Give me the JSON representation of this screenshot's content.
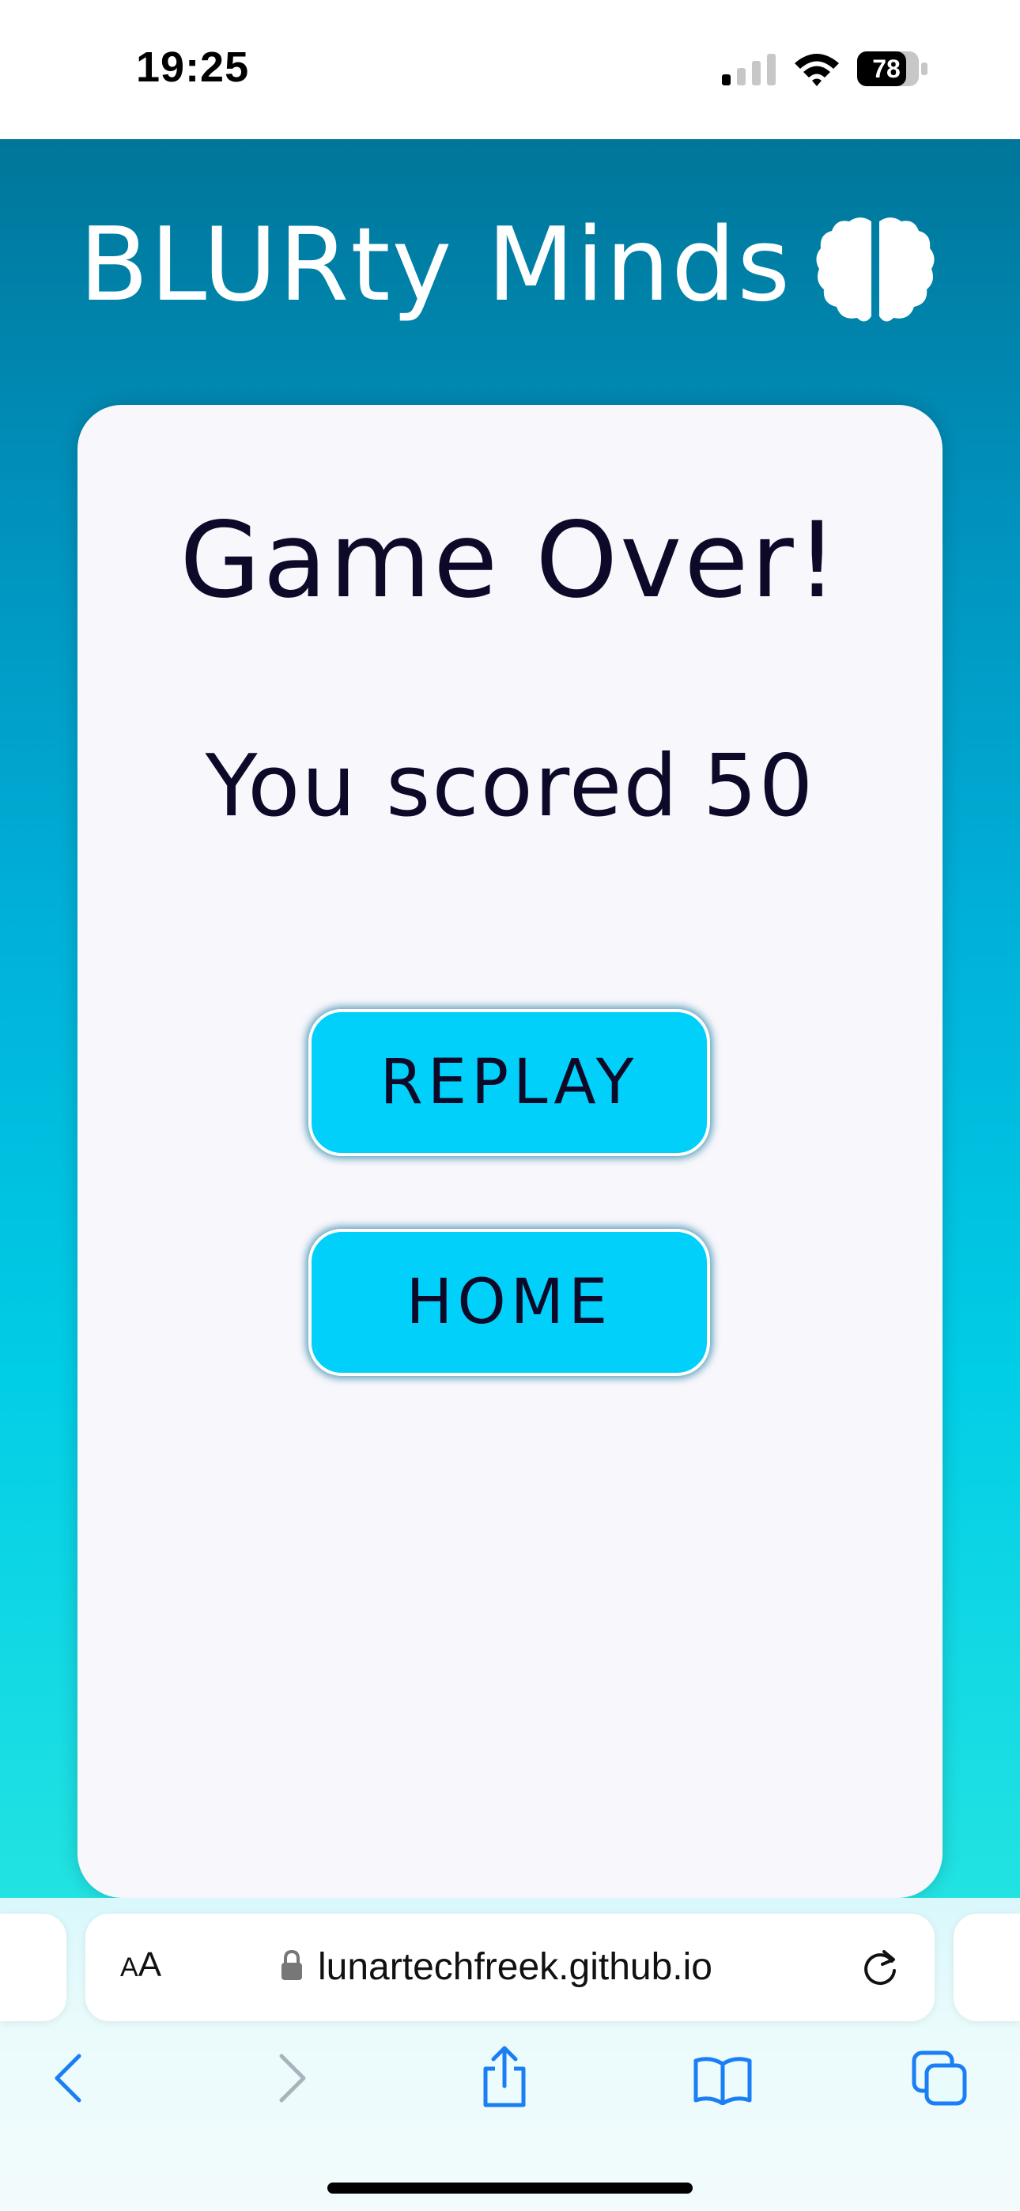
{
  "status_bar": {
    "time": "19:25",
    "battery": "78",
    "icons": [
      "signal-icon",
      "wifi-icon",
      "battery-icon"
    ]
  },
  "header": {
    "title": "BLURty Minds",
    "logo_icon": "brain-icon"
  },
  "card": {
    "title": "Game Over!",
    "score_prefix": "You scored",
    "score_value": "50",
    "buttons": {
      "replay": "REPLAY",
      "home": "HOME"
    }
  },
  "browser": {
    "reader_small": "A",
    "reader_big": "A",
    "url": "lunartechfreek.github.io",
    "toolbar_icons": [
      "back-icon",
      "forward-icon",
      "share-icon",
      "bookmarks-icon",
      "tabs-icon"
    ]
  },
  "colors": {
    "accent_button": "#00d0fa",
    "text_dark": "#0c0a28",
    "background_top": "#00769a",
    "background_bottom": "#22e3e2",
    "card": "#f8f7fc",
    "browser_blue": "#1a7ef5"
  }
}
